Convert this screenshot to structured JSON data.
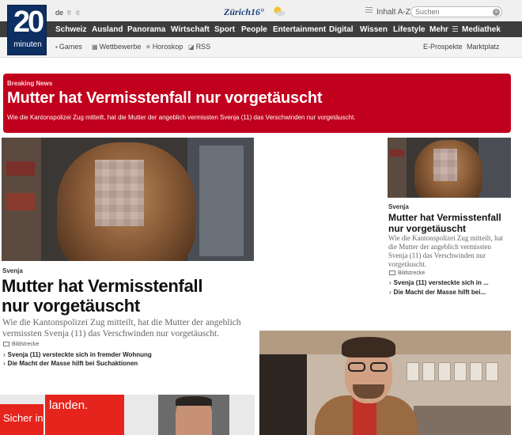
{
  "header": {
    "logo_number": "20",
    "logo_word": "minuten",
    "languages": [
      {
        "code": "de",
        "active": true
      },
      {
        "code": "fr",
        "active": false
      },
      {
        "code": "it",
        "active": false
      }
    ],
    "weather": {
      "city": "Zürich",
      "temp": "16°",
      "icon": "sun-cloud-icon"
    },
    "az_label": "Inhalt A-Z",
    "search_placeholder": "Suchen"
  },
  "nav": {
    "items": [
      "Schweiz",
      "Ausland",
      "Panorama",
      "Wirtschaft",
      "Sport",
      "People",
      "Entertainment",
      "Digital",
      "Wissen",
      "Lifestyle",
      "Mehr",
      "Mediathek"
    ]
  },
  "subnav": {
    "left": [
      {
        "label": "Games",
        "icon": "gamepad-icon"
      },
      {
        "label": "Wettbewerbe",
        "icon": "gift-icon"
      },
      {
        "label": "Horoskop",
        "icon": "star-icon"
      },
      {
        "label": "RSS",
        "icon": "rss-icon"
      }
    ],
    "right": [
      "E-Prospekte",
      "Marktplatz"
    ]
  },
  "breaking": {
    "label": "Breaking News",
    "headline": "Mutter hat Vermisstenfall nur vorgetäuscht",
    "lead": "Wie die Kantonspolizei Zug mitteilt, hat die Mutter der angeblich vermissten Svenja (11) das Verschwinden nur vorgetäuscht."
  },
  "main_article": {
    "kicker": "Svenja",
    "headline_line1": "Mutter hat Vermisstenfall",
    "headline_line2": "nur vorgetäuscht",
    "lead_line1": "Wie die Kantonspolizei Zug mitteilt, hat die Mutter der angeblich",
    "lead_line2": "vermissten Svenja (11) das Verschwinden nur vorgetäuscht.",
    "bildstrecke": "Bildstrecke",
    "related": [
      "Svenja (11) versteckte sich in fremder Wohnung",
      "Die Macht der Masse hilft bei Suchaktionen"
    ]
  },
  "side_article": {
    "kicker": "Svenja",
    "headline_line1": "Mutter hat Vermisstenfall",
    "headline_line2": "nur vorgetäuscht",
    "lead_lines": [
      "Wie die Kantonspolizei Zug mitteilt, hat",
      "die Mutter der angeblich vermissten",
      "Svenja (11) das Verschwinden nur",
      "vorgetäuscht."
    ],
    "bildstrecke": "Bildstrecke",
    "related": [
      "Svenja (11) versteckte sich in ...",
      "Die Macht der Masse hilft bei..."
    ]
  },
  "bottom_left": {
    "ad_text_1": "Sicher in",
    "ad_text_2": "landen."
  }
}
